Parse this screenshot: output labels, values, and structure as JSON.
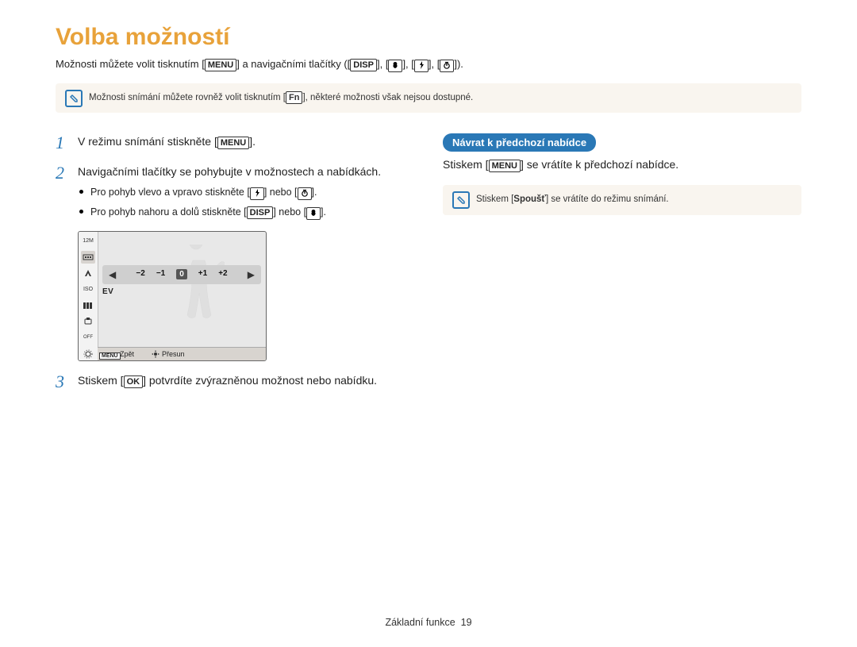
{
  "title": "Volba možností",
  "intro": {
    "prefix": "Možnosti můžete volit tisknutím [",
    "menu": "MENU",
    "mid": "] a navigačními tlačítky ([",
    "disp": "DISP",
    "sep": "], [",
    "end": "])."
  },
  "note1": {
    "prefix": "Možnosti snímání můžete rovněž volit tisknutím [",
    "fn": "Fn",
    "suffix": "], některé možnosti však nejsou dostupné."
  },
  "steps": {
    "s1": {
      "num": "1",
      "prefix": "V režimu snímání stiskněte [",
      "menu": "MENU",
      "suffix": "]."
    },
    "s2": {
      "num": "2",
      "text": "Navigačními tlačítky se pohybujte v možnostech a nabídkách.",
      "b1_prefix": "Pro pohyb vlevo a vpravo stiskněte [",
      "b1_mid": "] nebo [",
      "b1_suffix": "].",
      "b2_prefix": "Pro pohyb nahoru a dolů stiskněte [",
      "b2_disp": "DISP",
      "b2_mid": "] nebo [",
      "b2_suffix": "]."
    },
    "s3": {
      "num": "3",
      "prefix": "Stiskem [",
      "ok": "OK",
      "suffix": "] potvrdíte zvýrazněnou možnost nebo nabídku."
    }
  },
  "lcd": {
    "sidebar_top": "12M",
    "sidebar_iso": "ISO",
    "ev_ticks": [
      "−2",
      "−1",
      "0",
      "+1",
      "+2"
    ],
    "ev_label": "EV",
    "footer_back": "Zpět",
    "footer_move": "Přesun",
    "footer_menu": "MENU"
  },
  "right": {
    "heading": "Návrat k předchozí nabídce",
    "text_prefix": "Stiskem [",
    "menu": "MENU",
    "text_suffix": "] se vrátíte k předchozí nabídce.",
    "note_prefix": "Stiskem [",
    "note_btn": "Spoušť",
    "note_suffix": "] se vrátíte do režimu snímání."
  },
  "footer": {
    "label": "Základní funkce",
    "page": "19"
  }
}
